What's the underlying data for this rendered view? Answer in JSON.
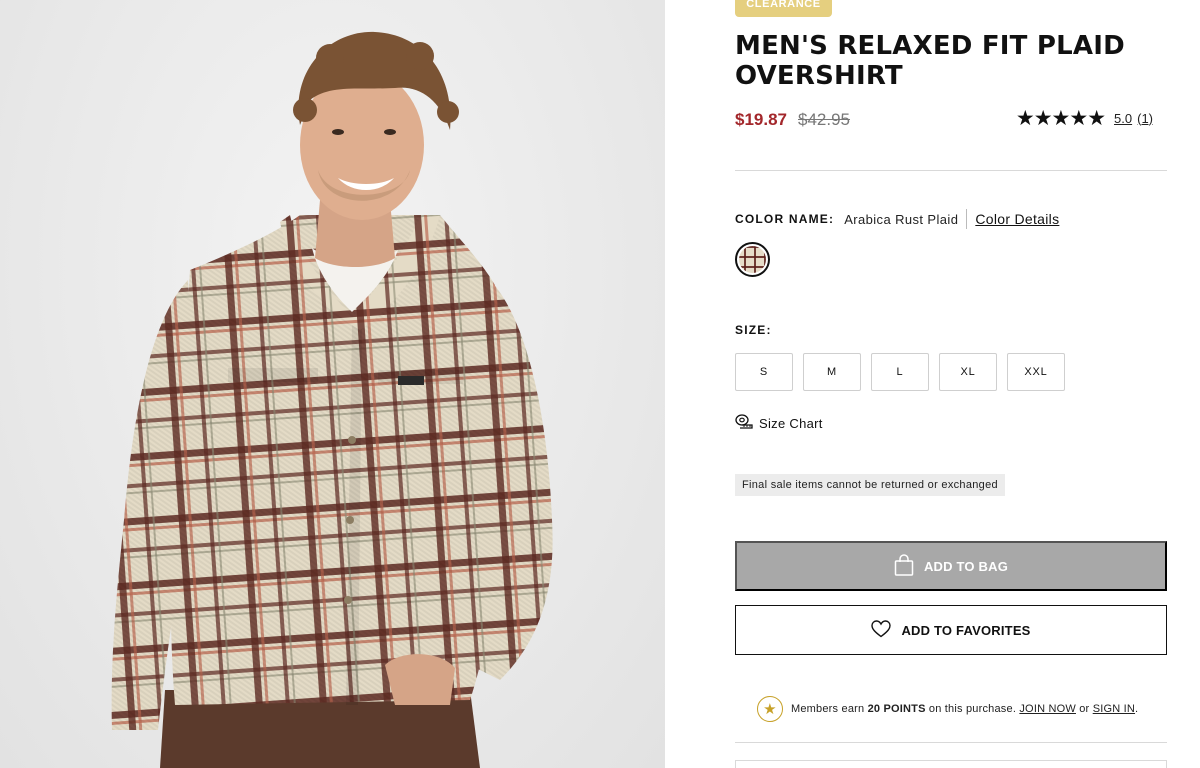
{
  "product": {
    "badge": "CLEARANCE",
    "title_line1": "MEN'S RELAXED FIT PLAID",
    "title_line2": "OVERSHIRT",
    "price_sale": "$19.87",
    "price_original": "$42.95",
    "stars": "★★★★★",
    "rating_value": "5.0",
    "rating_count": "(1)",
    "image_alt": "Man wearing plaid overshirt"
  },
  "color": {
    "label": "COLOR NAME:",
    "name": "Arabica Rust Plaid",
    "details_link": "Color Details",
    "swatch_icon": "plaid-swatch"
  },
  "size": {
    "label": "SIZE:",
    "options": [
      "S",
      "M",
      "L",
      "XL",
      "XXL"
    ],
    "chart_link": "Size Chart",
    "chart_icon": "measuring-tape-icon"
  },
  "notice": "Final sale items cannot be returned or exchanged",
  "actions": {
    "add_to_bag": "ADD TO BAG",
    "add_to_favorites": "ADD TO FAVORITES"
  },
  "members": {
    "prefix": "Members earn",
    "points": "20 POINTS",
    "middle": "on this purchase.",
    "join": "JOIN NOW",
    "or": "or",
    "sign_in": "SIGN IN",
    "suffix": "."
  },
  "colors": {
    "sale_red": "#a3272b",
    "badge_gold": "#e5cf7f",
    "disabled_gray": "#a8a8a8",
    "points_gold": "#c7a128"
  }
}
